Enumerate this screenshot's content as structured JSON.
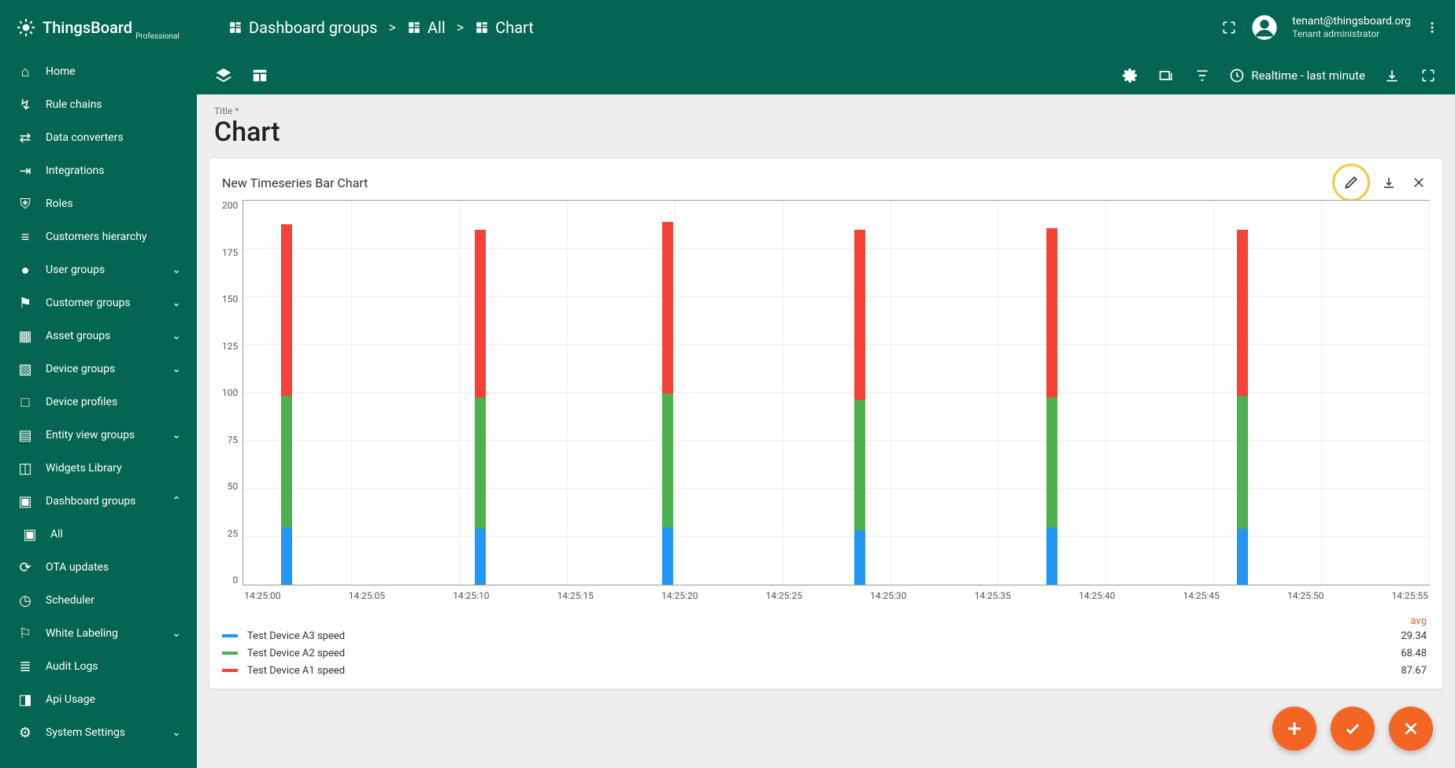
{
  "brand": {
    "name": "ThingsBoard",
    "edition": "Professional"
  },
  "breadcrumb": {
    "root": "Dashboard groups",
    "group": "All",
    "page": "Chart"
  },
  "user": {
    "email": "tenant@thingsboard.org",
    "role": "Tenant administrator"
  },
  "toolbar": {
    "time_label": "Realtime - last minute"
  },
  "sidebar": {
    "items": [
      {
        "label": "Home"
      },
      {
        "label": "Rule chains"
      },
      {
        "label": "Data converters"
      },
      {
        "label": "Integrations"
      },
      {
        "label": "Roles"
      },
      {
        "label": "Customers hierarchy"
      },
      {
        "label": "User groups",
        "expandable": true
      },
      {
        "label": "Customer groups",
        "expandable": true
      },
      {
        "label": "Asset groups",
        "expandable": true
      },
      {
        "label": "Device groups",
        "expandable": true
      },
      {
        "label": "Device profiles"
      },
      {
        "label": "Entity view groups",
        "expandable": true
      },
      {
        "label": "Widgets Library"
      },
      {
        "label": "Dashboard groups",
        "expandable": true,
        "expanded": true,
        "children": [
          {
            "label": "All"
          }
        ]
      },
      {
        "label": "OTA updates"
      },
      {
        "label": "Scheduler"
      },
      {
        "label": "White Labeling",
        "expandable": true
      },
      {
        "label": "Audit Logs"
      },
      {
        "label": "Api Usage"
      },
      {
        "label": "System Settings",
        "expandable": true
      }
    ]
  },
  "dashboard": {
    "title_label": "Title *",
    "title": "Chart"
  },
  "widget": {
    "title": "New Timeseries Bar Chart"
  },
  "legend": {
    "avg_header": "avg",
    "rows": [
      {
        "label": "Test Device A3 speed",
        "avg": "29.34",
        "color": "#2196f3"
      },
      {
        "label": "Test Device A2 speed",
        "avg": "68.48",
        "color": "#4caf50"
      },
      {
        "label": "Test Device A1 speed",
        "avg": "87.67",
        "color": "#f44336"
      }
    ]
  },
  "chart_data": {
    "type": "bar",
    "stacked": true,
    "title": "New Timeseries Bar Chart",
    "xlabel": "",
    "ylabel": "",
    "ylim": [
      0,
      200
    ],
    "yticks": [
      0,
      25,
      50,
      75,
      100,
      125,
      150,
      175,
      200
    ],
    "xticks": [
      "14:25:00",
      "14:25:05",
      "14:25:10",
      "14:25:15",
      "14:25:20",
      "14:25:25",
      "14:25:30",
      "14:25:35",
      "14:25:40",
      "14:25:45",
      "14:25:50",
      "14:25:55"
    ],
    "categories": [
      "14:24:58",
      "14:25:08",
      "14:25:18",
      "14:25:28",
      "14:25:38",
      "14:25:48"
    ],
    "series": [
      {
        "name": "Test Device A3 speed",
        "color": "#2196f3",
        "values": [
          30,
          29,
          30,
          28,
          30,
          29
        ]
      },
      {
        "name": "Test Device A2 speed",
        "color": "#4caf50",
        "values": [
          68,
          68,
          69,
          68,
          67,
          69
        ]
      },
      {
        "name": "Test Device A1 speed",
        "color": "#f44336",
        "values": [
          89,
          87,
          89,
          88,
          88,
          86
        ]
      }
    ]
  }
}
